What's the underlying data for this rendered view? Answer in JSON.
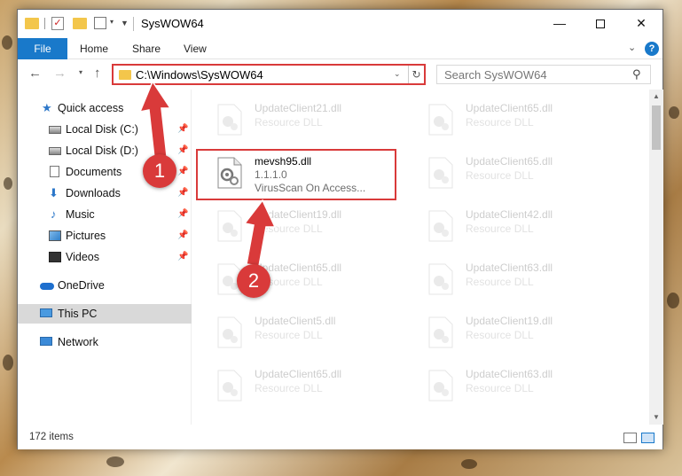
{
  "window": {
    "title": "SysWOW64",
    "min_glyph": "—",
    "close_glyph": "✕"
  },
  "ribbon": {
    "tabs": [
      {
        "label": "File"
      },
      {
        "label": "Home"
      },
      {
        "label": "Share"
      },
      {
        "label": "View"
      }
    ],
    "help_glyph": "?"
  },
  "address": {
    "path": "C:\\Windows\\SysWOW64",
    "search_placeholder": "Search SysWOW64"
  },
  "navpane": {
    "items": [
      {
        "label": "Quick access",
        "icon": "star-icon"
      },
      {
        "label": "Local Disk (C:)",
        "icon": "drive-icon",
        "pinned": true
      },
      {
        "label": "Local Disk (D:)",
        "icon": "drive-icon",
        "pinned": true
      },
      {
        "label": "Documents",
        "icon": "document-icon",
        "pinned": true
      },
      {
        "label": "Downloads",
        "icon": "download-icon",
        "pinned": true
      },
      {
        "label": "Music",
        "icon": "music-icon",
        "pinned": true
      },
      {
        "label": "Pictures",
        "icon": "pictures-icon",
        "pinned": true
      },
      {
        "label": "Videos",
        "icon": "videos-icon",
        "pinned": true
      },
      {
        "label": "OneDrive",
        "icon": "cloud-icon"
      },
      {
        "label": "This PC",
        "icon": "computer-icon",
        "selected": true
      },
      {
        "label": "Network",
        "icon": "network-icon"
      }
    ]
  },
  "files": [
    {
      "name": "UpdateClient21.dll",
      "sub1": "Resource DLL",
      "faded": true
    },
    {
      "name": "UpdateClient65.dll",
      "sub1": "Resource DLL",
      "faded": true
    },
    {
      "name": "mevsh95.dll",
      "sub1": "1.1.1.0",
      "sub2": "VirusScan On Access...",
      "faded": false
    },
    {
      "name": "UpdateClient65.dll",
      "sub1": "Resource DLL",
      "faded": true
    },
    {
      "name": "UpdateClient19.dll",
      "sub1": "Resource DLL",
      "faded": true
    },
    {
      "name": "UpdateClient42.dll",
      "sub1": "Resource DLL",
      "faded": true
    },
    {
      "name": "UpdateClient65.dll",
      "sub1": "Resource DLL",
      "faded": true
    },
    {
      "name": "UpdateClient63.dll",
      "sub1": "Resource DLL",
      "faded": true
    },
    {
      "name": "UpdateClient5.dll",
      "sub1": "Resource DLL",
      "faded": true
    },
    {
      "name": "UpdateClient19.dll",
      "sub1": "Resource DLL",
      "faded": true
    },
    {
      "name": "UpdateClient65.dll",
      "sub1": "Resource DLL",
      "faded": true
    },
    {
      "name": "UpdateClient63.dll",
      "sub1": "Resource DLL",
      "faded": true
    }
  ],
  "status": {
    "item_count": "172 items"
  },
  "annotations": [
    {
      "number": "1"
    },
    {
      "number": "2"
    }
  ],
  "colors": {
    "accent": "#1979ca",
    "highlight": "#d93a3a",
    "folder": "#f3c64b"
  }
}
